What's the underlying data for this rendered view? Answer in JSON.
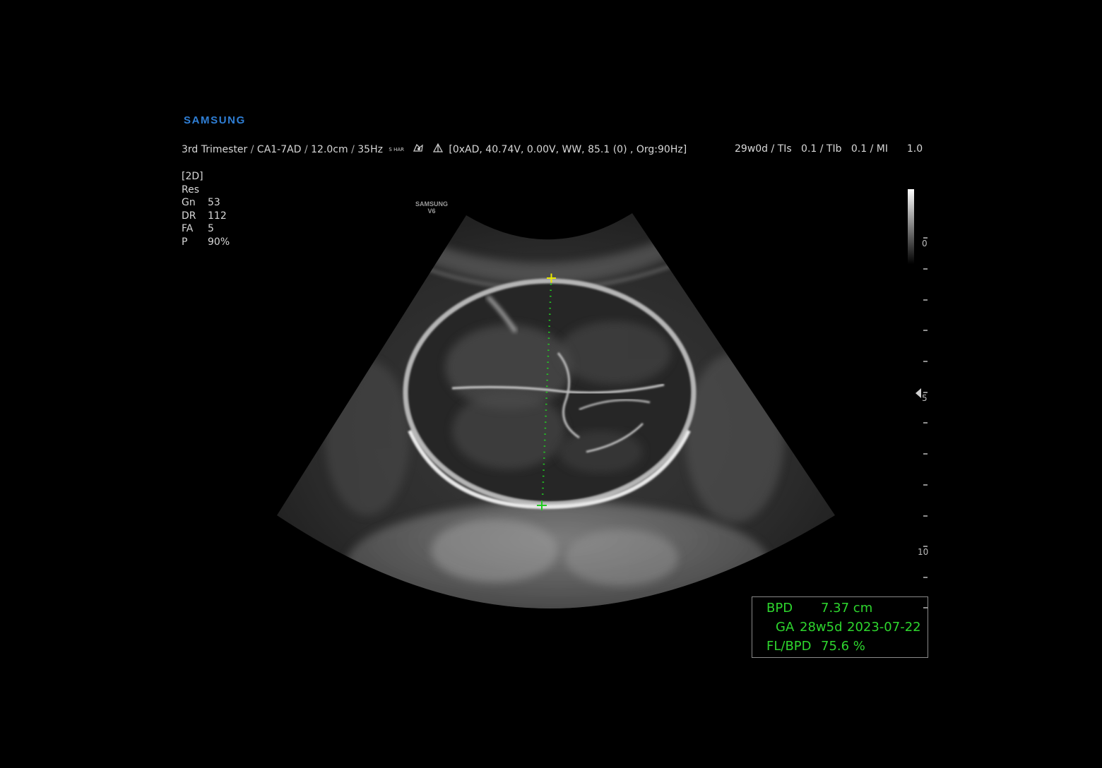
{
  "brand": {
    "logo_text": "SAMSUNG",
    "probe_brand": "SAMSUNG",
    "probe_model": "V6"
  },
  "header": {
    "preset": "3rd Trimester",
    "probe": "CA1-7AD",
    "depth": "12.0cm",
    "frame_rate": "35Hz",
    "har_label": "S HAR",
    "tech_info": "[0xAD, 40.74V, 0.00V, WW, 85.1 (0) , Org:90Hz]",
    "ga": "29w0d",
    "tis_label": "TIs",
    "tis_value": "0.1",
    "tib_label": "TIb",
    "tib_value": "0.1",
    "mi_label": "MI",
    "mi_value": "1.0"
  },
  "params": {
    "mode": "[2D]",
    "res": "Res",
    "items": [
      {
        "label": "Gn",
        "value": "53"
      },
      {
        "label": "DR",
        "value": "112"
      },
      {
        "label": "FA",
        "value": "5"
      },
      {
        "label": "P",
        "value": "90%"
      }
    ]
  },
  "depth_scale": {
    "labels": [
      "0",
      "5",
      "10"
    ]
  },
  "measurement": {
    "bpd_label": "BPD",
    "bpd_value": "7.37 cm",
    "ga_label": "GA",
    "ga_value": "28w5d",
    "edd": "2023-07-22",
    "ratio_label": "FL/BPD",
    "ratio_value": "75.6 %"
  },
  "colors": {
    "caliper_start": "#e8e800",
    "caliper_end": "#22cc22",
    "measure_text": "#2ed62e",
    "logo": "#2f7fd6"
  }
}
